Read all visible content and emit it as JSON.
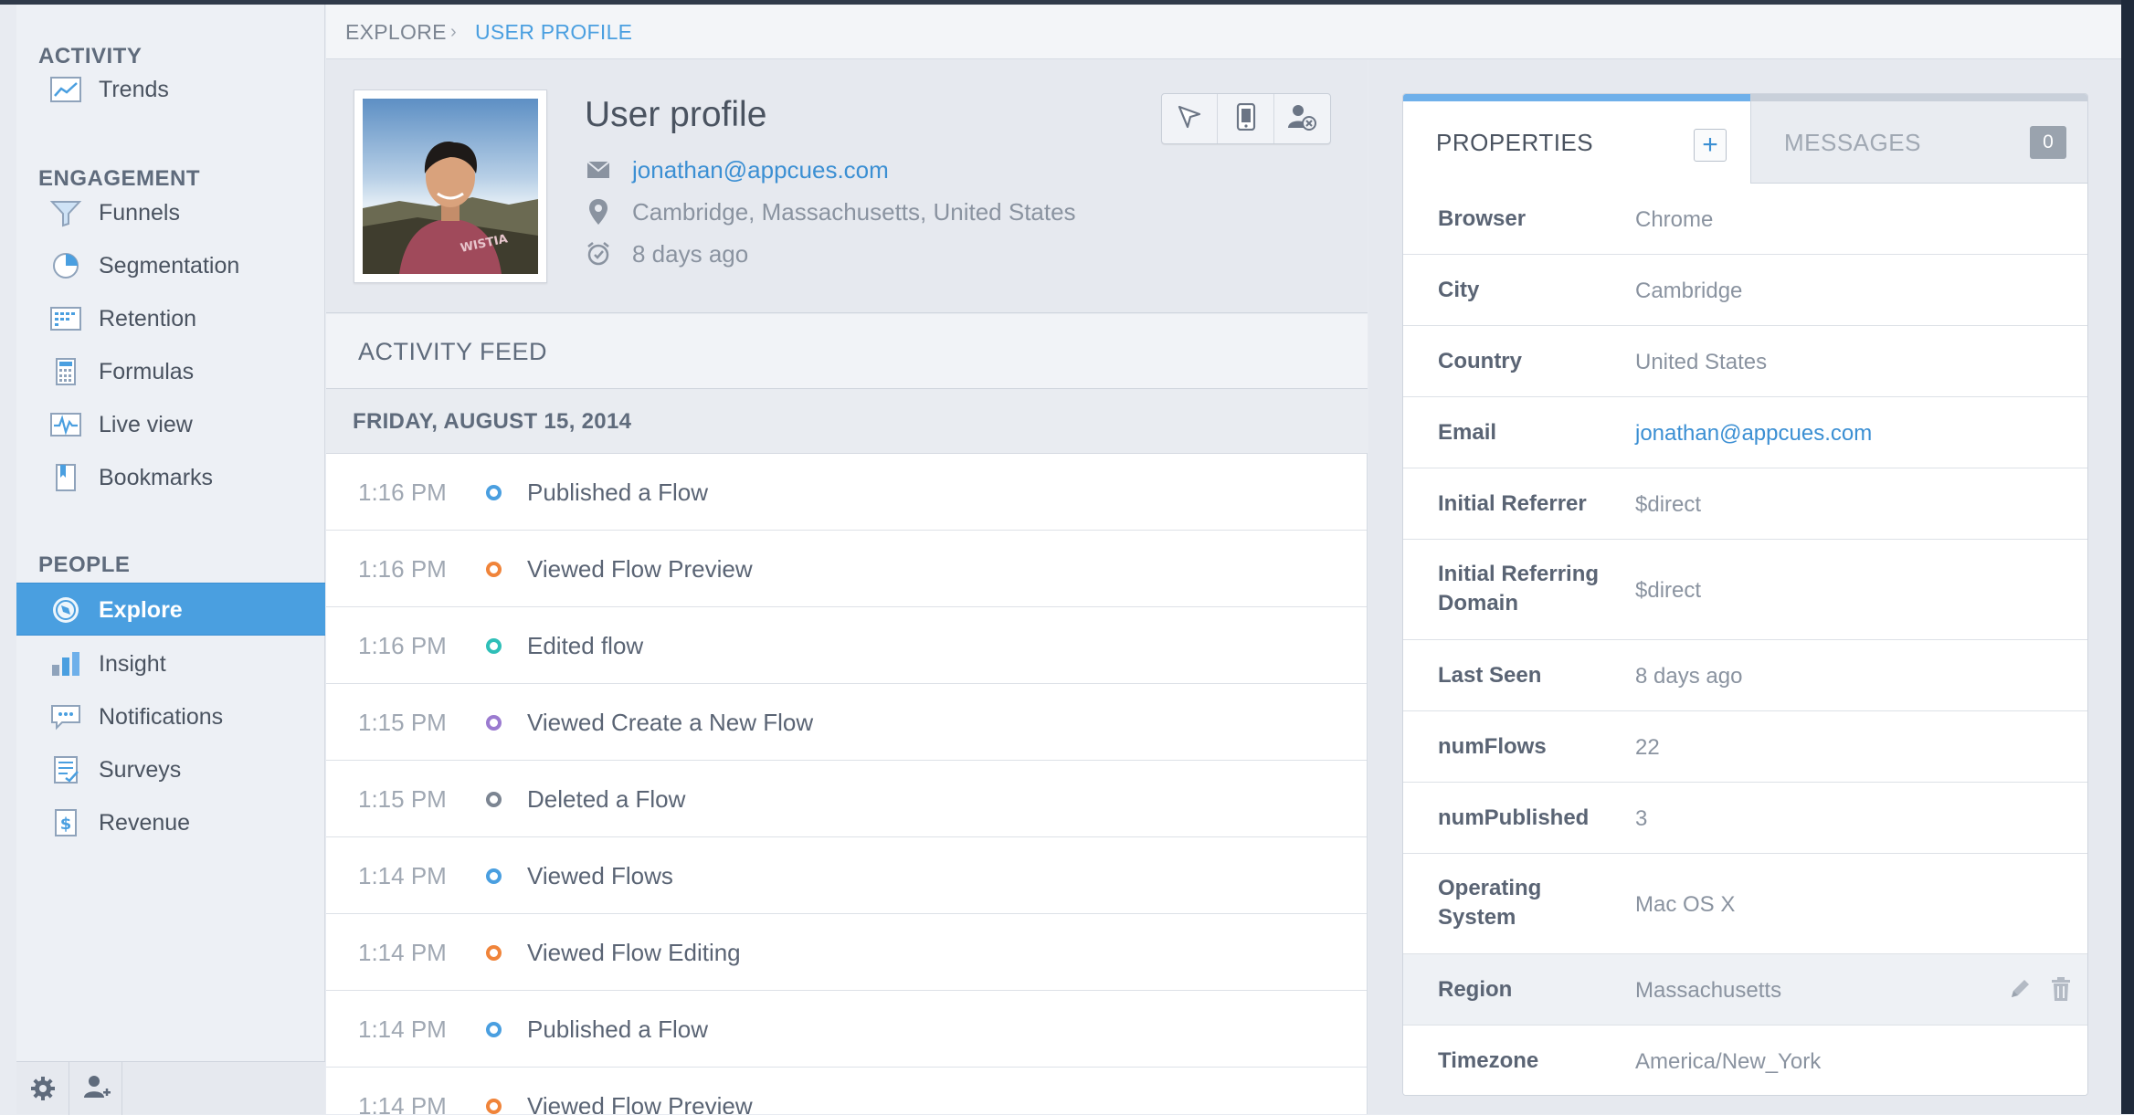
{
  "sidebar": {
    "sections": {
      "activity": "ACTIVITY",
      "engagement": "ENGAGEMENT",
      "people": "PEOPLE"
    },
    "items": [
      {
        "label": "Trends",
        "icon": "trends-icon"
      },
      {
        "label": "Funnels",
        "icon": "funnel-icon"
      },
      {
        "label": "Segmentation",
        "icon": "pie-chart-icon"
      },
      {
        "label": "Retention",
        "icon": "retention-grid-icon"
      },
      {
        "label": "Formulas",
        "icon": "calculator-icon"
      },
      {
        "label": "Live view",
        "icon": "live-pulse-icon"
      },
      {
        "label": "Bookmarks",
        "icon": "bookmark-icon"
      },
      {
        "label": "Explore",
        "icon": "explore-icon",
        "active": true
      },
      {
        "label": "Insight",
        "icon": "bar-chart-icon"
      },
      {
        "label": "Notifications",
        "icon": "chat-bubble-icon"
      },
      {
        "label": "Surveys",
        "icon": "checklist-icon"
      },
      {
        "label": "Revenue",
        "icon": "dollar-icon"
      }
    ],
    "footer": {
      "settings_icon": "gear-icon",
      "add_user_icon": "add-user-icon"
    }
  },
  "breadcrumb": {
    "root": "EXPLORE",
    "current": "USER PROFILE"
  },
  "profile": {
    "title": "User profile",
    "email": "jonathan@appcues.com",
    "location": "Cambridge, Massachusetts, United States",
    "last_seen": "8 days ago",
    "tools": [
      "cursor-icon",
      "mobile-device-icon",
      "remove-user-icon"
    ]
  },
  "feed": {
    "heading": "ACTIVITY FEED",
    "date": "FRIDAY, AUGUST 15, 2014",
    "events": [
      {
        "time": "1:16 PM",
        "event": "Published a Flow",
        "color": "#4a9fe0"
      },
      {
        "time": "1:16 PM",
        "event": "Viewed Flow Preview",
        "color": "#f0843a"
      },
      {
        "time": "1:16 PM",
        "event": "Edited flow",
        "color": "#2fbfb8"
      },
      {
        "time": "1:15 PM",
        "event": "Viewed Create a New Flow",
        "color": "#9b7bd0"
      },
      {
        "time": "1:15 PM",
        "event": "Deleted a Flow",
        "color": "#7c8592"
      },
      {
        "time": "1:14 PM",
        "event": "Viewed Flows",
        "color": "#4a9fe0"
      },
      {
        "time": "1:14 PM",
        "event": "Viewed Flow Editing",
        "color": "#f0843a"
      },
      {
        "time": "1:14 PM",
        "event": "Published a Flow",
        "color": "#4a9fe0"
      },
      {
        "time": "1:14 PM",
        "event": "Viewed Flow Preview",
        "color": "#f0843a"
      }
    ]
  },
  "panel": {
    "tab_properties": "PROPERTIES",
    "tab_messages": "MESSAGES",
    "add_label": "+",
    "messages_count": "0",
    "properties": [
      {
        "key": "Browser",
        "value": "Chrome"
      },
      {
        "key": "City",
        "value": "Cambridge"
      },
      {
        "key": "Country",
        "value": "United States"
      },
      {
        "key": "Email",
        "value": "jonathan@appcues.com",
        "link": true
      },
      {
        "key": "Initial Referrer",
        "value": "$direct"
      },
      {
        "key": "Initial Referring Domain",
        "value": "$direct"
      },
      {
        "key": "Last Seen",
        "value": "8 days ago"
      },
      {
        "key": "numFlows",
        "value": "22"
      },
      {
        "key": "numPublished",
        "value": "3"
      },
      {
        "key": "Operating System",
        "value": "Mac OS X"
      },
      {
        "key": "Region",
        "value": "Massachusetts",
        "hover": true
      },
      {
        "key": "Timezone",
        "value": "America/New_York"
      }
    ]
  },
  "colors": {
    "accent": "#4a9fe0",
    "link": "#3b8fd3",
    "text": "#4a5360",
    "muted": "#8a93a0"
  }
}
